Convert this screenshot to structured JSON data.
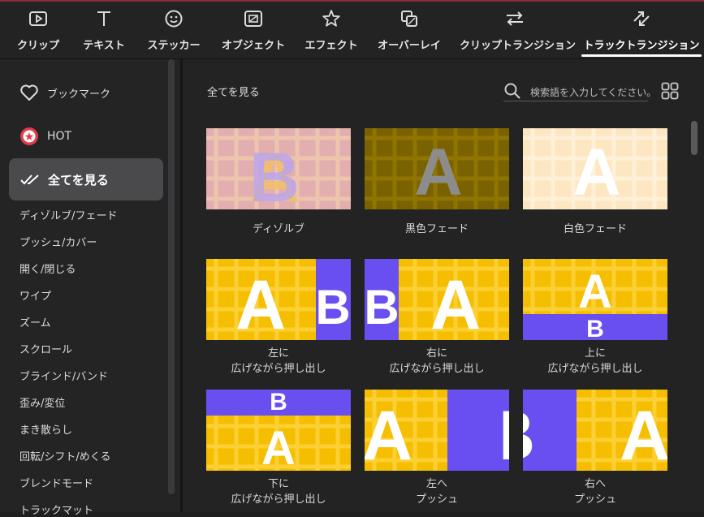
{
  "tabs": [
    {
      "label": "クリップ",
      "icon": "clip-icon",
      "active": false
    },
    {
      "label": "テキスト",
      "icon": "text-icon",
      "active": false
    },
    {
      "label": "ステッカー",
      "icon": "sticker-icon",
      "active": false
    },
    {
      "label": "オブジェクト",
      "icon": "object-icon",
      "active": false
    },
    {
      "label": "エフェクト",
      "icon": "effect-icon",
      "active": false
    },
    {
      "label": "オーバーレイ",
      "icon": "overlay-icon",
      "active": false
    },
    {
      "label": "クリップトランジション",
      "icon": "clip-transition-icon",
      "active": false
    },
    {
      "label": "トラックトランジション",
      "icon": "track-transition-icon",
      "active": true
    }
  ],
  "sidebar": {
    "bookmark": "ブックマーク",
    "hot": "HOT",
    "all": "全てを見る",
    "items": [
      "ディゾルブ/フェード",
      "プッシュ/カバー",
      "開く/閉じる",
      "ワイプ",
      "ズーム",
      "スクロール",
      "ブラインド/バンド",
      "歪み/変位",
      "まき散らし",
      "回転/シフト/めくる",
      "ブレンドモード",
      "トラックマット"
    ]
  },
  "main": {
    "title": "全てを見る",
    "search_placeholder": "検索語を入力してください。",
    "cards": [
      {
        "label": "ディゾルブ",
        "thumb": "dissolve"
      },
      {
        "label": "黒色フェード",
        "thumb": "fade-black"
      },
      {
        "label": "白色フェード",
        "thumb": "fade-white"
      },
      {
        "label": "左に\n広げながら押し出し",
        "thumb": "push-left"
      },
      {
        "label": "右に\n広げながら押し出し",
        "thumb": "push-right"
      },
      {
        "label": "上に\n広げながら押し出し",
        "thumb": "push-up"
      },
      {
        "label": "下に\n広げながら押し出し",
        "thumb": "push-down"
      },
      {
        "label": "左へ\nプッシュ",
        "thumb": "push-to-left"
      },
      {
        "label": "右へ\nプッシュ",
        "thumb": "push-to-right"
      }
    ],
    "thumb_text": {
      "a": "A",
      "b": "B"
    }
  },
  "colors": {
    "yellow": "#f5be00",
    "purple": "#6a4ff0",
    "accent": "#ffffff"
  }
}
